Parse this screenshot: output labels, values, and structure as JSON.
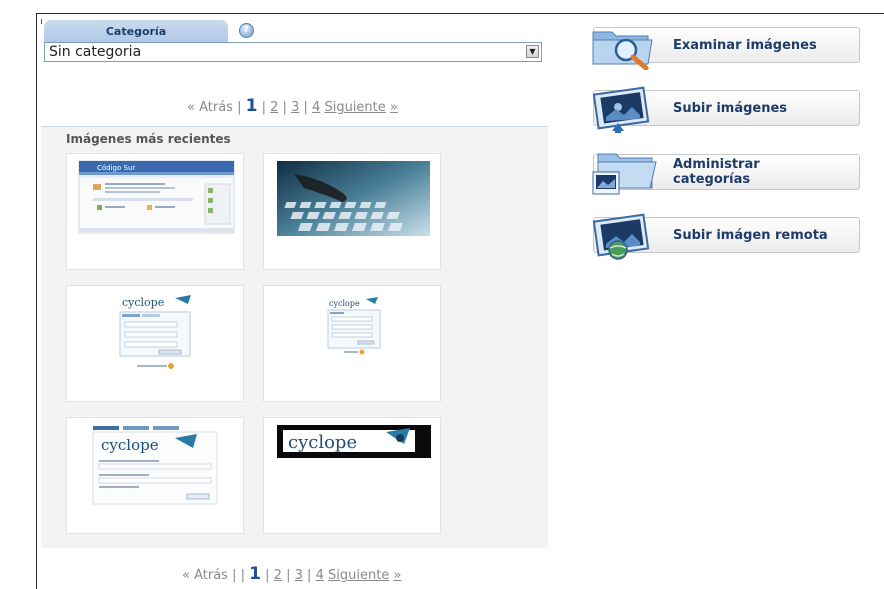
{
  "category": {
    "tab_label": "Categoría",
    "help_icon": "?",
    "selected": "Sin categoria",
    "dropdown_arrow": "▼"
  },
  "pager_top": {
    "prev": "« Atrás",
    "sep1": "|",
    "current": "1",
    "sep2": "|",
    "p2": "2",
    "sep3": "|",
    "p3": "3",
    "sep4": "|",
    "p4": "4",
    "next": "Siguiente",
    "next_arrow": "»"
  },
  "pager_bottom": {
    "prev": "« Atrás",
    "sep0": "|",
    "sep1": "|",
    "current": "1",
    "sep2": "|",
    "p2": "2",
    "sep3": "|",
    "p3": "3",
    "sep4": "|",
    "p4": "4",
    "next": "Siguiente",
    "next_arrow": "»"
  },
  "gallery": {
    "title": "Imágenes más recientes",
    "thumbs": [
      {
        "kind": "website-screenshot",
        "header_text": "Código Sur"
      },
      {
        "kind": "keyboard-photo"
      },
      {
        "kind": "cyclope-login",
        "logo": "cyclope"
      },
      {
        "kind": "cyclope-login-small",
        "logo": "cyclope"
      },
      {
        "kind": "cyclope-form",
        "logo": "cyclope"
      },
      {
        "kind": "cyclope-banner",
        "logo": "cyclope"
      }
    ]
  },
  "actions": [
    {
      "label": "Examinar imágenes",
      "icon": "folder-search-icon"
    },
    {
      "label": "Subir imágenes",
      "icon": "upload-image-icon"
    },
    {
      "label_line1": "Administrar",
      "label_line2": "categorías",
      "icon": "folder-images-icon"
    },
    {
      "label": "Subir imágen remota",
      "icon": "remote-image-icon"
    }
  ],
  "colors": {
    "accent": "#1f4f99",
    "tab_bg": "#b0c9e6",
    "button_text": "#1f3c6b",
    "gallery_bg": "#f3f3f3"
  }
}
